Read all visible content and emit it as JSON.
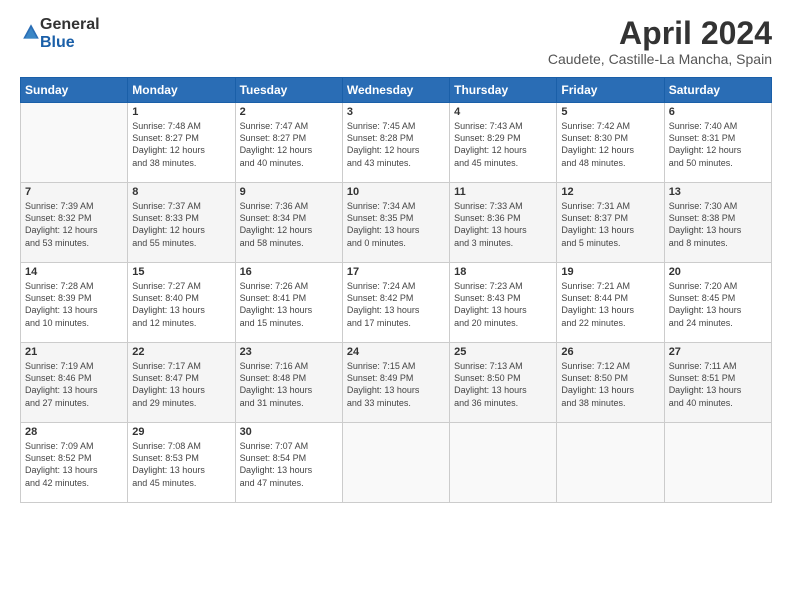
{
  "header": {
    "logo_general": "General",
    "logo_blue": "Blue",
    "title": "April 2024",
    "subtitle": "Caudete, Castille-La Mancha, Spain"
  },
  "days_of_week": [
    "Sunday",
    "Monday",
    "Tuesday",
    "Wednesday",
    "Thursday",
    "Friday",
    "Saturday"
  ],
  "weeks": [
    [
      {
        "day": "",
        "info": ""
      },
      {
        "day": "1",
        "info": "Sunrise: 7:48 AM\nSunset: 8:27 PM\nDaylight: 12 hours\nand 38 minutes."
      },
      {
        "day": "2",
        "info": "Sunrise: 7:47 AM\nSunset: 8:27 PM\nDaylight: 12 hours\nand 40 minutes."
      },
      {
        "day": "3",
        "info": "Sunrise: 7:45 AM\nSunset: 8:28 PM\nDaylight: 12 hours\nand 43 minutes."
      },
      {
        "day": "4",
        "info": "Sunrise: 7:43 AM\nSunset: 8:29 PM\nDaylight: 12 hours\nand 45 minutes."
      },
      {
        "day": "5",
        "info": "Sunrise: 7:42 AM\nSunset: 8:30 PM\nDaylight: 12 hours\nand 48 minutes."
      },
      {
        "day": "6",
        "info": "Sunrise: 7:40 AM\nSunset: 8:31 PM\nDaylight: 12 hours\nand 50 minutes."
      }
    ],
    [
      {
        "day": "7",
        "info": "Sunrise: 7:39 AM\nSunset: 8:32 PM\nDaylight: 12 hours\nand 53 minutes."
      },
      {
        "day": "8",
        "info": "Sunrise: 7:37 AM\nSunset: 8:33 PM\nDaylight: 12 hours\nand 55 minutes."
      },
      {
        "day": "9",
        "info": "Sunrise: 7:36 AM\nSunset: 8:34 PM\nDaylight: 12 hours\nand 58 minutes."
      },
      {
        "day": "10",
        "info": "Sunrise: 7:34 AM\nSunset: 8:35 PM\nDaylight: 13 hours\nand 0 minutes."
      },
      {
        "day": "11",
        "info": "Sunrise: 7:33 AM\nSunset: 8:36 PM\nDaylight: 13 hours\nand 3 minutes."
      },
      {
        "day": "12",
        "info": "Sunrise: 7:31 AM\nSunset: 8:37 PM\nDaylight: 13 hours\nand 5 minutes."
      },
      {
        "day": "13",
        "info": "Sunrise: 7:30 AM\nSunset: 8:38 PM\nDaylight: 13 hours\nand 8 minutes."
      }
    ],
    [
      {
        "day": "14",
        "info": "Sunrise: 7:28 AM\nSunset: 8:39 PM\nDaylight: 13 hours\nand 10 minutes."
      },
      {
        "day": "15",
        "info": "Sunrise: 7:27 AM\nSunset: 8:40 PM\nDaylight: 13 hours\nand 12 minutes."
      },
      {
        "day": "16",
        "info": "Sunrise: 7:26 AM\nSunset: 8:41 PM\nDaylight: 13 hours\nand 15 minutes."
      },
      {
        "day": "17",
        "info": "Sunrise: 7:24 AM\nSunset: 8:42 PM\nDaylight: 13 hours\nand 17 minutes."
      },
      {
        "day": "18",
        "info": "Sunrise: 7:23 AM\nSunset: 8:43 PM\nDaylight: 13 hours\nand 20 minutes."
      },
      {
        "day": "19",
        "info": "Sunrise: 7:21 AM\nSunset: 8:44 PM\nDaylight: 13 hours\nand 22 minutes."
      },
      {
        "day": "20",
        "info": "Sunrise: 7:20 AM\nSunset: 8:45 PM\nDaylight: 13 hours\nand 24 minutes."
      }
    ],
    [
      {
        "day": "21",
        "info": "Sunrise: 7:19 AM\nSunset: 8:46 PM\nDaylight: 13 hours\nand 27 minutes."
      },
      {
        "day": "22",
        "info": "Sunrise: 7:17 AM\nSunset: 8:47 PM\nDaylight: 13 hours\nand 29 minutes."
      },
      {
        "day": "23",
        "info": "Sunrise: 7:16 AM\nSunset: 8:48 PM\nDaylight: 13 hours\nand 31 minutes."
      },
      {
        "day": "24",
        "info": "Sunrise: 7:15 AM\nSunset: 8:49 PM\nDaylight: 13 hours\nand 33 minutes."
      },
      {
        "day": "25",
        "info": "Sunrise: 7:13 AM\nSunset: 8:50 PM\nDaylight: 13 hours\nand 36 minutes."
      },
      {
        "day": "26",
        "info": "Sunrise: 7:12 AM\nSunset: 8:50 PM\nDaylight: 13 hours\nand 38 minutes."
      },
      {
        "day": "27",
        "info": "Sunrise: 7:11 AM\nSunset: 8:51 PM\nDaylight: 13 hours\nand 40 minutes."
      }
    ],
    [
      {
        "day": "28",
        "info": "Sunrise: 7:09 AM\nSunset: 8:52 PM\nDaylight: 13 hours\nand 42 minutes."
      },
      {
        "day": "29",
        "info": "Sunrise: 7:08 AM\nSunset: 8:53 PM\nDaylight: 13 hours\nand 45 minutes."
      },
      {
        "day": "30",
        "info": "Sunrise: 7:07 AM\nSunset: 8:54 PM\nDaylight: 13 hours\nand 47 minutes."
      },
      {
        "day": "",
        "info": ""
      },
      {
        "day": "",
        "info": ""
      },
      {
        "day": "",
        "info": ""
      },
      {
        "day": "",
        "info": ""
      }
    ]
  ]
}
